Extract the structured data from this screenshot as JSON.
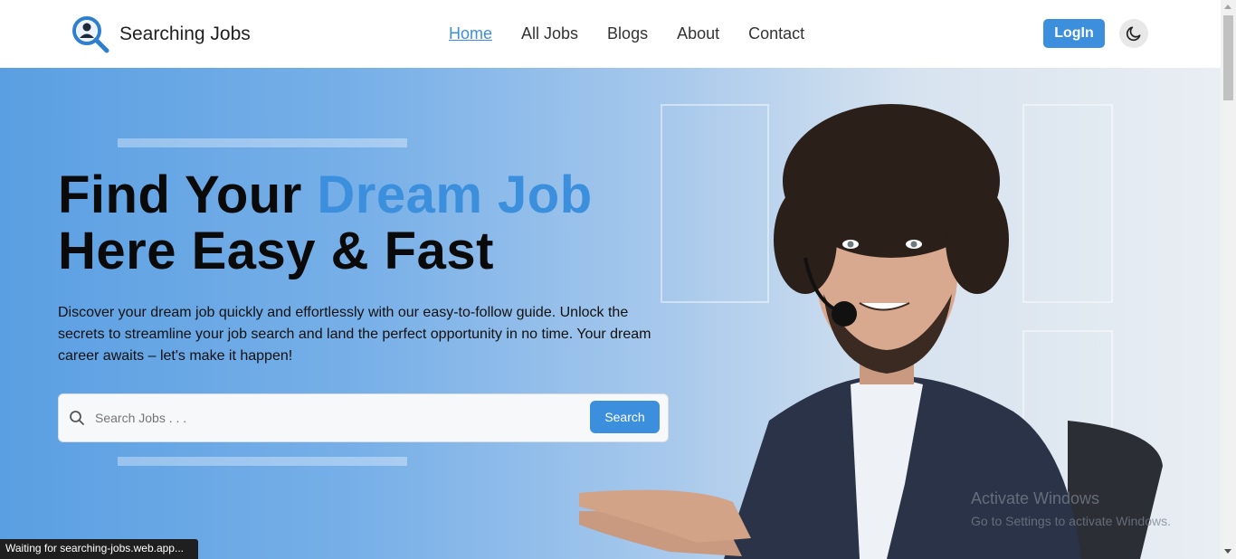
{
  "header": {
    "logo_text": "Searching Jobs",
    "nav": [
      "Home",
      "All Jobs",
      "Blogs",
      "About",
      "Contact"
    ],
    "active_nav": "Home",
    "login_label": "LogIn",
    "theme_icon": "moon-icon"
  },
  "hero": {
    "headline_line1_a": "Find Your ",
    "headline_line1_b": "Dream Job",
    "headline_line2": "Here Easy & Fast",
    "description": "Discover your dream job quickly and effortlessly with our easy-to-follow guide. Unlock the secrets to streamline your job search and land the perfect opportunity in no time. Your dream career awaits – let's make it happen!",
    "search_placeholder": "Search Jobs . . .",
    "search_button": "Search"
  },
  "overlay": {
    "activate_title": "Activate Windows",
    "activate_sub": "Go to Settings to activate Windows."
  },
  "status_bar": "Waiting for searching-jobs.web.app...",
  "colors": {
    "accent": "#3b8fdc",
    "text": "#0a0a0a"
  }
}
